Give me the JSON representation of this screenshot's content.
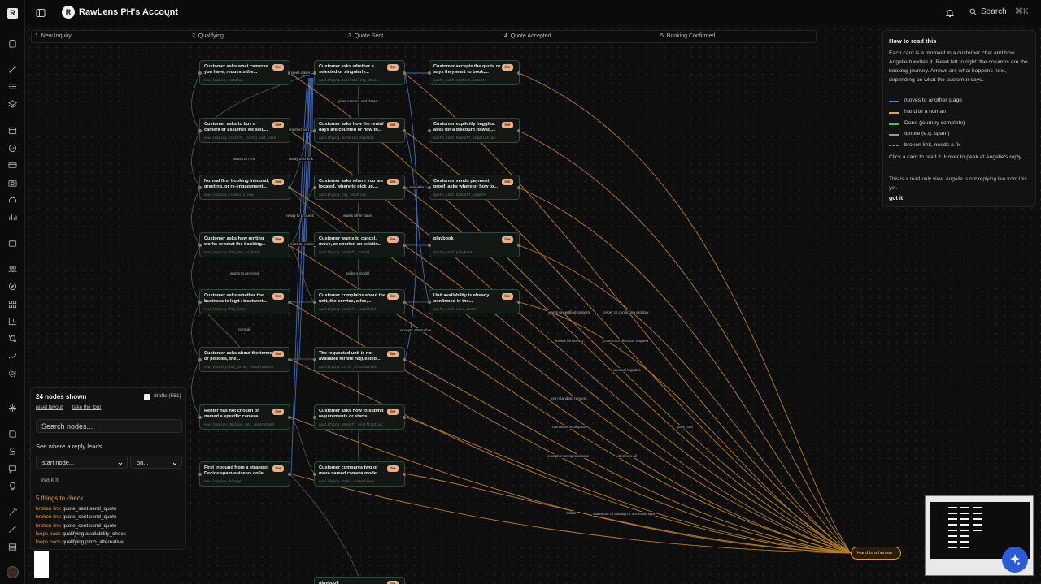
{
  "header": {
    "account_initial": "R",
    "account_name": "RawLens PH's Account",
    "search_label": "Search",
    "search_shortcut": "⌘K"
  },
  "stages": [
    "1. New Inquiry",
    "2. Qualifying",
    "3. Quote Sent",
    "4. Quote Accepted",
    "5. Booking Confirmed"
  ],
  "badge_label": "live",
  "nodes": {
    "new_inquiry_catalog": {
      "title": "Customer asks what cameras you have, requests the...",
      "id": "new_inquiry.catalog"
    },
    "new_inquiry_clarify": {
      "title": "Customer asks to buy a camera or assumes we sell,...",
      "id": "new_inquiry.clarify_rental_not_sale"
    },
    "new_inquiry_classify": {
      "title": "Normal first booking inbound, greeting, or re-engagement...",
      "id": "new_inquiry.classify_new"
    },
    "new_inquiry_how": {
      "title": "Customer asks how renting works or what the booking...",
      "id": "new_inquiry.faq_how_to_book"
    },
    "new_inquiry_legit": {
      "title": "Customer asks whether the business is legit / trustwort...",
      "id": "new_inquiry.faq_legit"
    },
    "new_inquiry_terms": {
      "title": "Customer asks about the terms or policies, the...",
      "id": "new_inquiry.faq_terms_requirements"
    },
    "new_inquiry_undecided": {
      "title": "Renter has not chosen or named a specific camera...",
      "id": "new_inquiry.decline_not_understand"
    },
    "new_inquiry_triage": {
      "title": "First inbound from a stranger. Decide spam/noise vs colla...",
      "id": "new_inquiry.triage"
    },
    "qualifying_availability": {
      "title": "Customer asks whether a selected or singularly...",
      "id": "qualifying.availability_check"
    },
    "qualifying_duration": {
      "title": "Customer asks how the rental days are counted or how th...",
      "id": "qualifying.duration_explain"
    },
    "qualifying_location": {
      "title": "Customer asks where you are located, where to pick up,...",
      "id": "qualifying.faq_location"
    },
    "qualifying_cancel": {
      "title": "Customer wants to cancel, move, or shorten an existin...",
      "id": "qualifying.handoff_cancel"
    },
    "qualifying_complains": {
      "title": "Customer complains about the unit, the service, a fee,...",
      "id": "qualifying.handoff_complaint"
    },
    "qualifying_pitch": {
      "title": "The requested unit is not available for the requested...",
      "id": "qualifying.pitch_alternative"
    },
    "qualifying_verification": {
      "title": "Customer asks how to submit requirements or starts...",
      "id": "qualifying.handoff_verification"
    },
    "qualifying_compare": {
      "title": "Customer compares two or more named camera model...",
      "id": "qualifying.model_comparison"
    },
    "qualifying_playbook": {
      "title": "playbook",
      "id": "qualifying.playbook"
    },
    "quote_accept": {
      "title": "Customer accepts the quote or says they want to book,...",
      "id": "quote_sent.confirm_accept"
    },
    "quote_haggle": {
      "title": "Customer explicitly haggles: asks for a discount (tawad,...",
      "id": "quote_sent.handoff_negotiation"
    },
    "quote_payment": {
      "title": "Customer sends payment proof, asks where or how to...",
      "id": "quote_sent.handoff_payment"
    },
    "quote_playbook": {
      "title": "playbook",
      "id": "quote_sent.playbook"
    },
    "quote_send": {
      "title": "Unit availability is already confirmed in the...",
      "id": "quote_sent.send_quote"
    },
    "hand_to_human": {
      "title": "Hand to a human"
    }
  },
  "edge_labels": [
    "gives dates",
    "gives camera and dates",
    "clarified and",
    "wants to rent",
    "ready to check",
    "available",
    "ready to process",
    "wants other dates",
    "picks an option",
    "wants to proceed",
    "picks a model",
    "normal",
    "accepts alternative",
    "wants uncertified camera",
    "longer or conflicting window",
    "insists on buying",
    "custom or discount request",
    "unusual logistics",
    "non standard request",
    "complaint or dispute",
    "goes cold",
    "exception or special case",
    "declines all",
    "collab",
    "wants out of catalog or uncertain spot"
  ],
  "help": {
    "title": "How to read this",
    "body": "Each card is a moment in a customer chat and how Angelie handles it. Read left to right: the columns are the booking journey. Arrows are what happens next, depending on what the customer says.",
    "legend": [
      {
        "label": "moves to another stage",
        "color": "#4f7fe0"
      },
      {
        "label": "hand to a human",
        "color": "#e8a33a"
      },
      {
        "label": "Done (journey complete)",
        "color": "#3ec36f"
      },
      {
        "label": "Ignore (e.g. spam)",
        "color": "#8a9bb0"
      },
      {
        "label": "broken link, needs a fix",
        "color": "#d86a6a"
      }
    ],
    "click_hint": "Click a card to read it. Hover to peek at Angelie's reply.",
    "readonly_note": "This is a read-only view. Angelie is not replying live from this yet.",
    "got_it": "got it"
  },
  "controls": {
    "count": "24 nodes shown",
    "drafts": "drafts (561)",
    "reset_layout": "reset layout",
    "take_tour": "take the tour",
    "search_placeholder": "Search nodes...",
    "reply_leads": "See where a reply leads",
    "start_node": "start node...",
    "on": "on...",
    "walk": "Walk it",
    "things_to_check": "5 things to check",
    "issues": [
      {
        "kind": "broken link",
        "target": "quote_sent.send_quote"
      },
      {
        "kind": "broken link",
        "target": "quote_sent.send_quote"
      },
      {
        "kind": "broken link",
        "target": "quote_sent.send_quote"
      },
      {
        "kind": "loops back",
        "target": "qualifying.availability_check"
      },
      {
        "kind": "loops back",
        "target": "qualifying.pitch_alternative"
      }
    ]
  }
}
